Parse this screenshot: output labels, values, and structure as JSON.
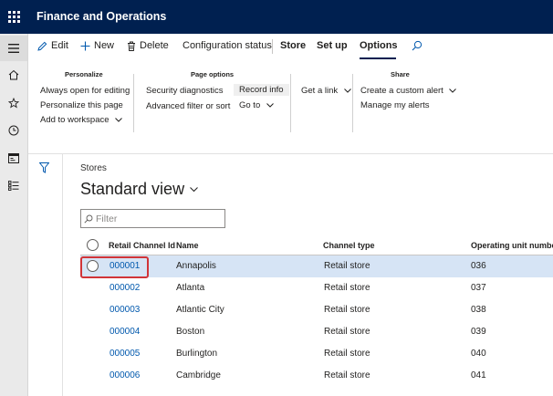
{
  "app": {
    "title": "Finance and Operations"
  },
  "actionpane": {
    "edit": "Edit",
    "new": "New",
    "delete": "Delete",
    "configuration_status": "Configuration status",
    "tabs": [
      "Store",
      "Set up",
      "Options"
    ],
    "active_tab": "Options",
    "search_icon": "search-icon",
    "groups": {
      "personalize": {
        "title": "Personalize",
        "items": [
          "Always open for editing",
          "Personalize this page",
          "Add to workspace"
        ]
      },
      "page_options": {
        "title": "Page options",
        "items": [
          "Security diagnostics",
          "Advanced filter or sort",
          "Record info",
          "Go to",
          "Get a link"
        ]
      },
      "share": {
        "title": "Share",
        "items": [
          "Create a custom alert",
          "Manage my alerts"
        ]
      }
    }
  },
  "nav": {
    "icons": [
      "hamburger-icon",
      "home-icon",
      "star-icon",
      "clock-icon",
      "workspace-icon",
      "list-icon"
    ]
  },
  "page": {
    "breadcrumb": "Stores",
    "view_title": "Standard view",
    "filter_placeholder": "Filter"
  },
  "grid": {
    "columns": [
      "Retail Channel Id",
      "Name",
      "Channel type",
      "Operating unit numbe"
    ],
    "rows": [
      {
        "id": "000001",
        "name": "Annapolis",
        "type": "Retail store",
        "unit": "036",
        "selected": true
      },
      {
        "id": "000002",
        "name": "Atlanta",
        "type": "Retail store",
        "unit": "037",
        "selected": false
      },
      {
        "id": "000003",
        "name": "Atlantic City",
        "type": "Retail store",
        "unit": "038",
        "selected": false
      },
      {
        "id": "000004",
        "name": "Boston",
        "type": "Retail store",
        "unit": "039",
        "selected": false
      },
      {
        "id": "000005",
        "name": "Burlington",
        "type": "Retail store",
        "unit": "040",
        "selected": false
      },
      {
        "id": "000006",
        "name": "Cambridge",
        "type": "Retail store",
        "unit": "041",
        "selected": false
      }
    ]
  },
  "colors": {
    "topbar": "#002050",
    "link": "#0058ad",
    "selected_row": "#d6e4f5",
    "highlight": "#d13438"
  }
}
